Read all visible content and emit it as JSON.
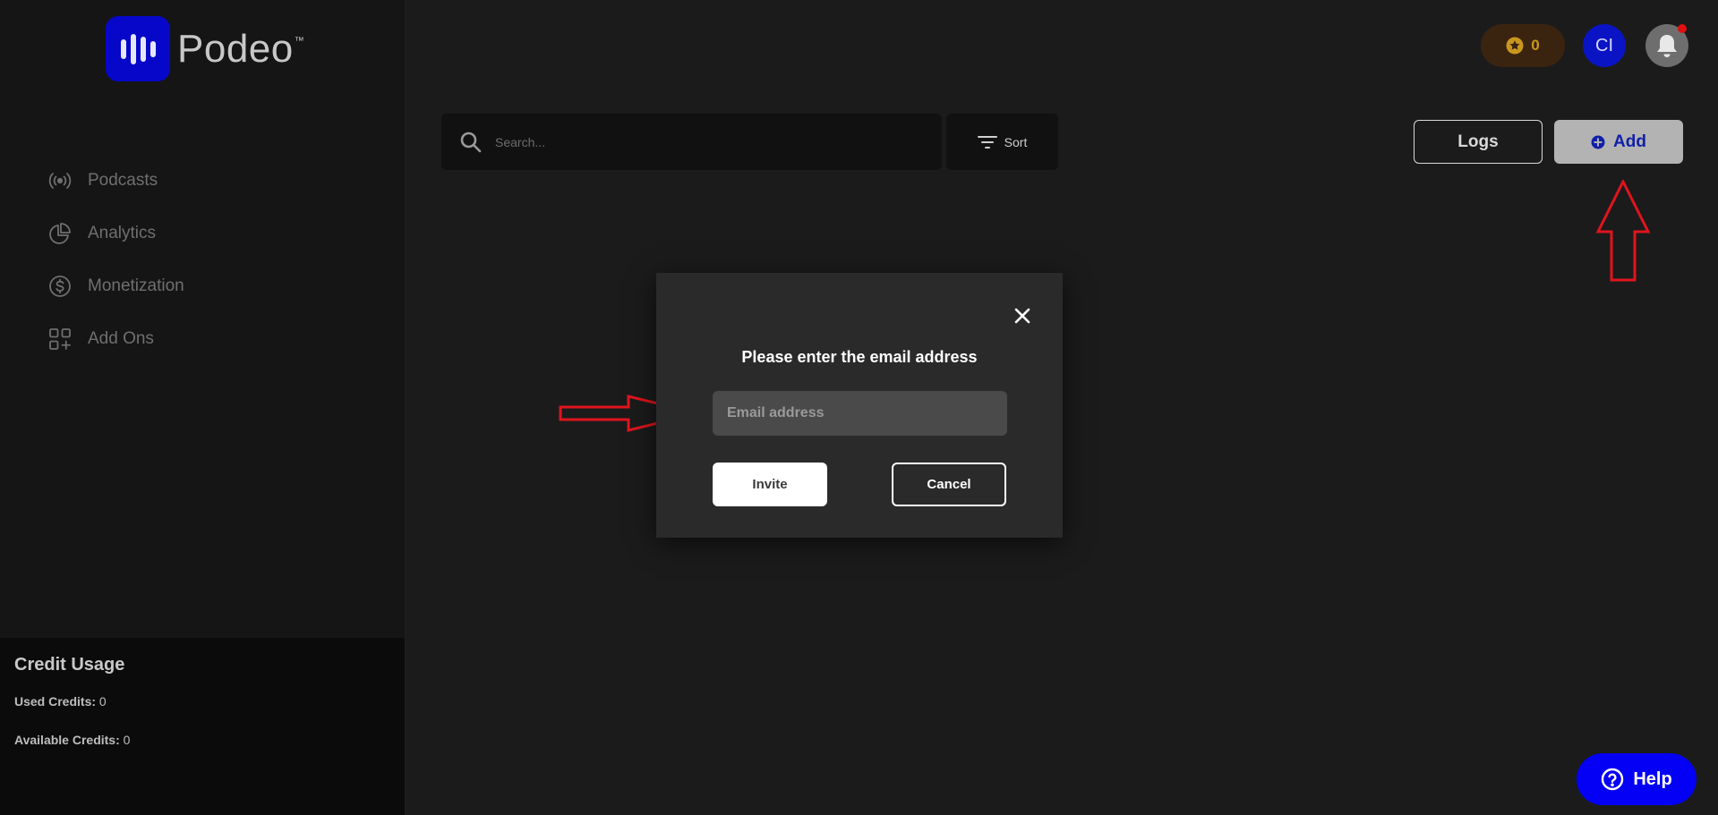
{
  "app": {
    "name": "Podeo",
    "trademark": "™"
  },
  "sidebar": {
    "items": [
      {
        "label": "Podcasts",
        "icon": "broadcast-icon"
      },
      {
        "label": "Analytics",
        "icon": "pie-chart-icon"
      },
      {
        "label": "Monetization",
        "icon": "dollar-circle-icon"
      },
      {
        "label": "Add Ons",
        "icon": "grid-plus-icon"
      }
    ]
  },
  "credit_usage": {
    "title": "Credit Usage",
    "used_label": "Used Credits:",
    "used_value": "0",
    "available_label": "Available Credits:",
    "available_value": "0"
  },
  "header": {
    "credits_count": "0",
    "avatar_initials": "CI",
    "has_notification": true
  },
  "toolbar": {
    "search_placeholder": "Search...",
    "sort_label": "Sort",
    "logs_label": "Logs",
    "add_label": "Add"
  },
  "modal": {
    "title": "Please enter the email address",
    "email_placeholder": "Email address",
    "invite_label": "Invite",
    "cancel_label": "Cancel"
  },
  "help": {
    "label": "Help"
  },
  "colors": {
    "brand": "#0707c9",
    "annotation_arrow": "#e0141e",
    "help_button": "#0400f5"
  }
}
